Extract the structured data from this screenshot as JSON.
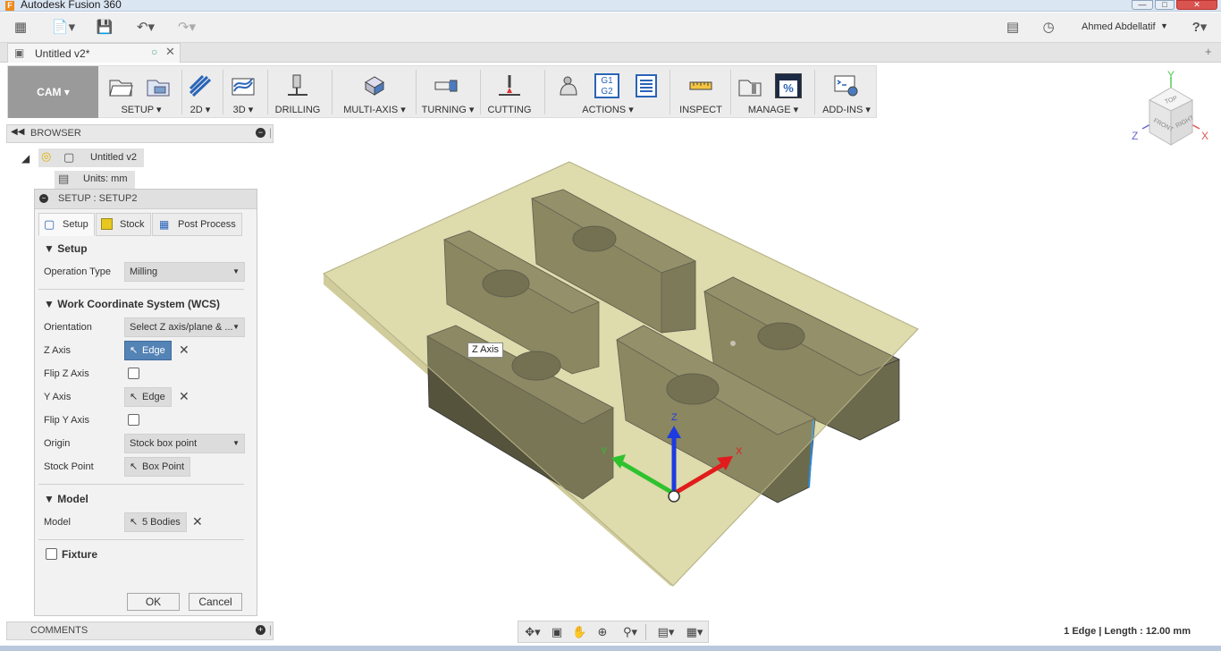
{
  "app": {
    "title": "Autodesk Fusion 360",
    "user": "Ahmed Abdellatif"
  },
  "document": {
    "tab_title": "Untitled v2*"
  },
  "ribbon": {
    "workspace": "CAM",
    "groups": [
      "SETUP",
      "2D",
      "3D",
      "DRILLING",
      "MULTI-AXIS",
      "TURNING",
      "CUTTING",
      "ACTIONS",
      "INSPECT",
      "MANAGE",
      "ADD-INS"
    ],
    "g1g2": "G1\nG2"
  },
  "browser": {
    "header": "BROWSER",
    "root": "Untitled v2",
    "units": "Units: mm",
    "ghost_setup": "Setup2"
  },
  "comments": {
    "header": "COMMENTS"
  },
  "dialog": {
    "title": "SETUP : SETUP2",
    "tabs": [
      "Setup",
      "Stock",
      "Post Process"
    ],
    "sections": {
      "setup": "Setup",
      "wcs": "Work Coordinate System (WCS)",
      "model": "Model",
      "fixture": "Fixture"
    },
    "fields": {
      "operation_type_label": "Operation Type",
      "operation_type_value": "Milling",
      "orientation_label": "Orientation",
      "orientation_value": "Select Z axis/plane & ...",
      "z_axis_label": "Z Axis",
      "z_axis_value": "Edge",
      "flip_z_label": "Flip Z Axis",
      "y_axis_label": "Y Axis",
      "y_axis_value": "Edge",
      "flip_y_label": "Flip Y Axis",
      "origin_label": "Origin",
      "origin_value": "Stock box point",
      "stock_point_label": "Stock Point",
      "stock_point_value": "Box Point",
      "model_label": "Model",
      "model_value": "5 Bodies"
    },
    "ok": "OK",
    "cancel": "Cancel"
  },
  "viewport": {
    "tooltip": "Z Axis",
    "axis_labels": {
      "x": "X",
      "y": "Y",
      "z": "Z"
    },
    "viewcube": {
      "top": "TOP",
      "front": "FRONT",
      "right": "RIGHT"
    }
  },
  "status": {
    "selection": "1 Edge | Length : 12.00 mm"
  },
  "colors": {
    "accent": "#5483b6",
    "stock": "#d9d6a4",
    "part": "#6e6a4e",
    "cam_bg": "#9a9a9a"
  }
}
